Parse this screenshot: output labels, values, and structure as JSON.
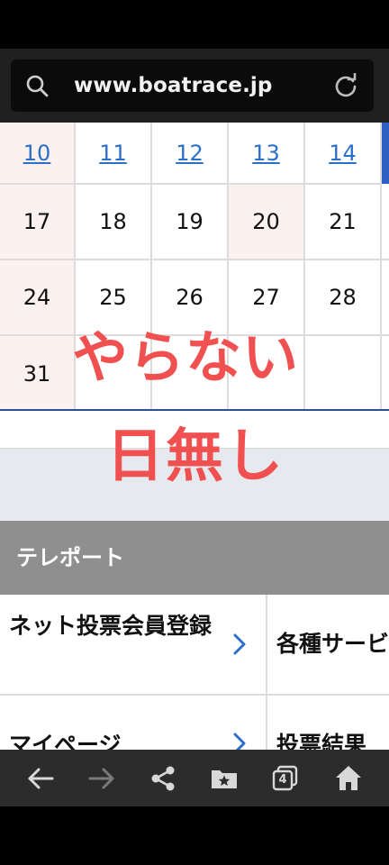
{
  "browser": {
    "url": "www.boatrace.jp",
    "icons": {
      "search": "search-icon",
      "reload": "reload-icon"
    }
  },
  "calendar": {
    "weeks": [
      {
        "days": [
          "10",
          "11",
          "12",
          "13",
          "14"
        ],
        "links": true
      },
      {
        "days": [
          "17",
          "18",
          "19",
          "20",
          "21"
        ],
        "links": false
      },
      {
        "days": [
          "24",
          "25",
          "26",
          "27",
          "28"
        ],
        "links": false
      },
      {
        "days": [
          "31",
          "",
          "",
          "",
          ""
        ],
        "links": false
      }
    ],
    "highlight_color": "#fbf1ee",
    "link_color": "#2a6fc9"
  },
  "annotation": {
    "line1": "やらない",
    "line2": "日無し",
    "color": "#f05050"
  },
  "section": {
    "title": "テレポート"
  },
  "menu": {
    "items": [
      {
        "label": "ネット投票会員登録"
      },
      {
        "label": "各種サービ"
      },
      {
        "label": "マイページ"
      },
      {
        "label": "投票結果"
      }
    ]
  },
  "bottom_nav": {
    "tab_count": "4",
    "icons": [
      "back-arrow-icon",
      "forward-arrow-icon",
      "share-icon",
      "bookmarks-icon",
      "tabs-icon",
      "home-icon"
    ]
  }
}
